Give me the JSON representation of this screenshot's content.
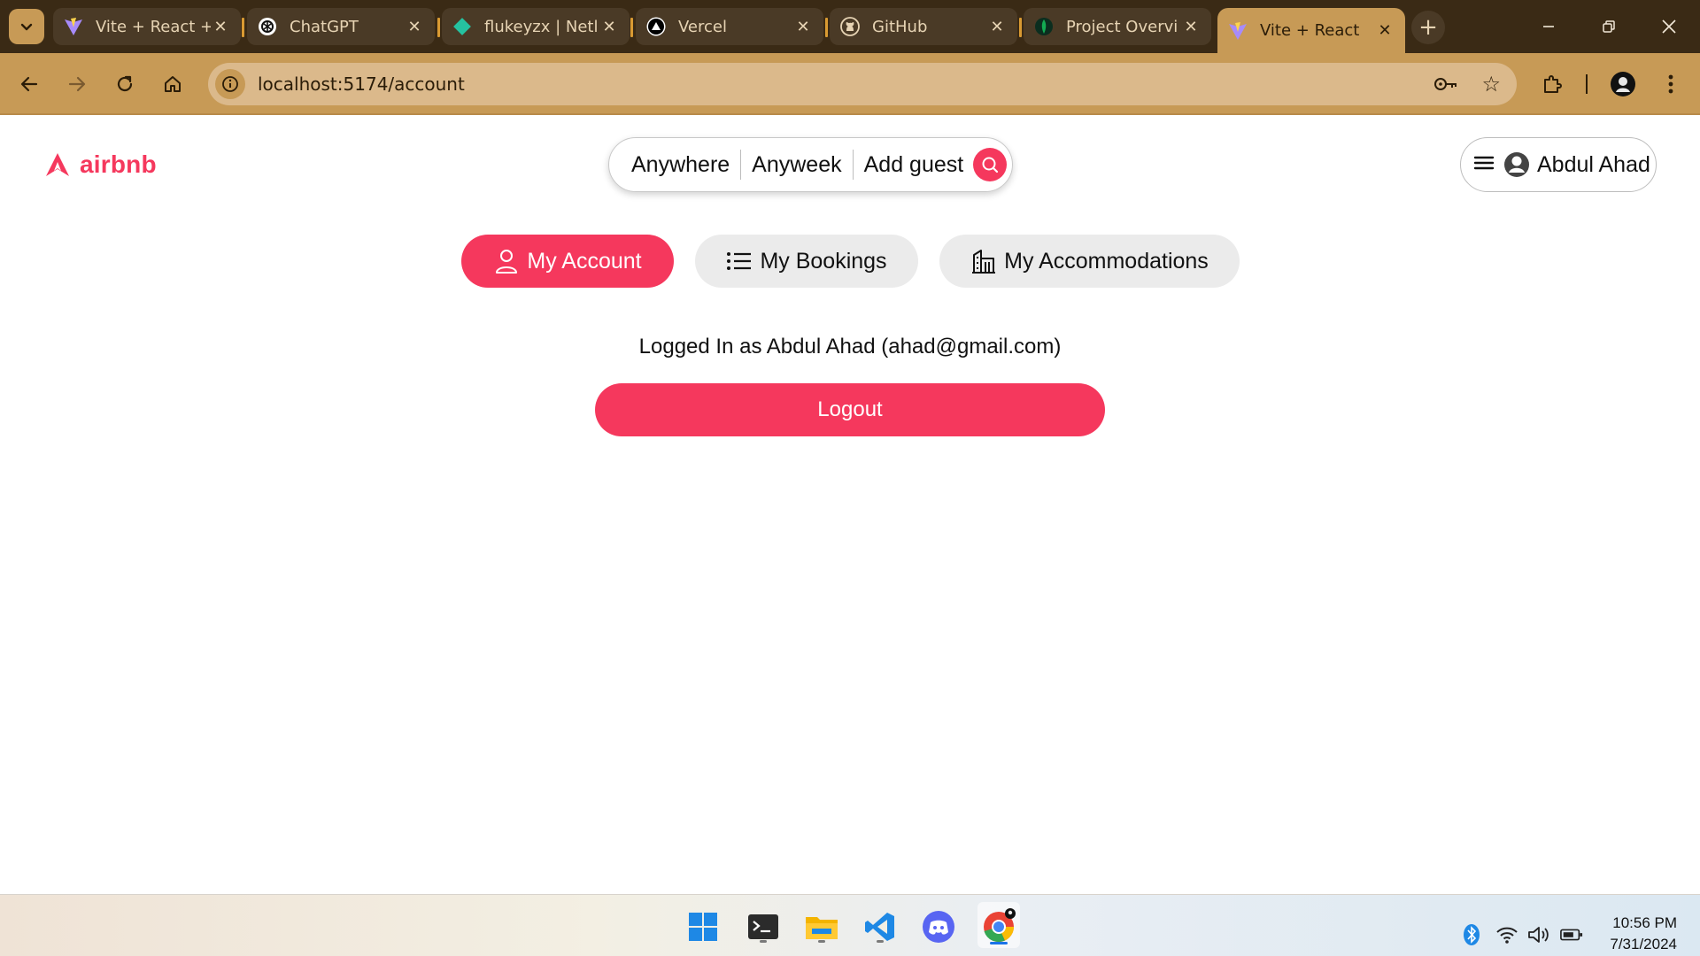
{
  "browser": {
    "tabs": [
      {
        "title": "Vite + React +",
        "favicon": "vite-icon",
        "active": false
      },
      {
        "title": "ChatGPT",
        "favicon": "chatgpt-icon",
        "active": false
      },
      {
        "title": "flukeyzx | Netl",
        "favicon": "netlify-icon",
        "active": false
      },
      {
        "title": "Vercel",
        "favicon": "vercel-icon",
        "active": false
      },
      {
        "title": "GitHub",
        "favicon": "github-icon",
        "active": false
      },
      {
        "title": "Project Overvi",
        "favicon": "mongodb-icon",
        "active": true
      },
      {
        "title": "Vite + React",
        "favicon": "vite-icon",
        "active": true
      }
    ],
    "url": "localhost:5174/account"
  },
  "header": {
    "logo_text": "airbnb",
    "search": {
      "where": "Anywhere",
      "when": "Anyweek",
      "who": "Add guest"
    },
    "user_name": "Abdul Ahad"
  },
  "account_nav": {
    "my_account": "My Account",
    "my_bookings": "My Bookings",
    "my_accommodations": "My Accommodations"
  },
  "profile": {
    "logged_in_text": "Logged In as Abdul Ahad (ahad@gmail.com)",
    "logout_label": "Logout"
  },
  "taskbar": {
    "apps": [
      "windows-start-icon",
      "terminal-icon",
      "file-explorer-icon",
      "vscode-icon",
      "discord-icon",
      "chrome-icon"
    ],
    "time": "10:56 PM",
    "date": "7/31/2024"
  },
  "colors": {
    "brand": "#f5385d",
    "browser_frame": "#c79a56",
    "tabstrip": "#3a2a15"
  }
}
